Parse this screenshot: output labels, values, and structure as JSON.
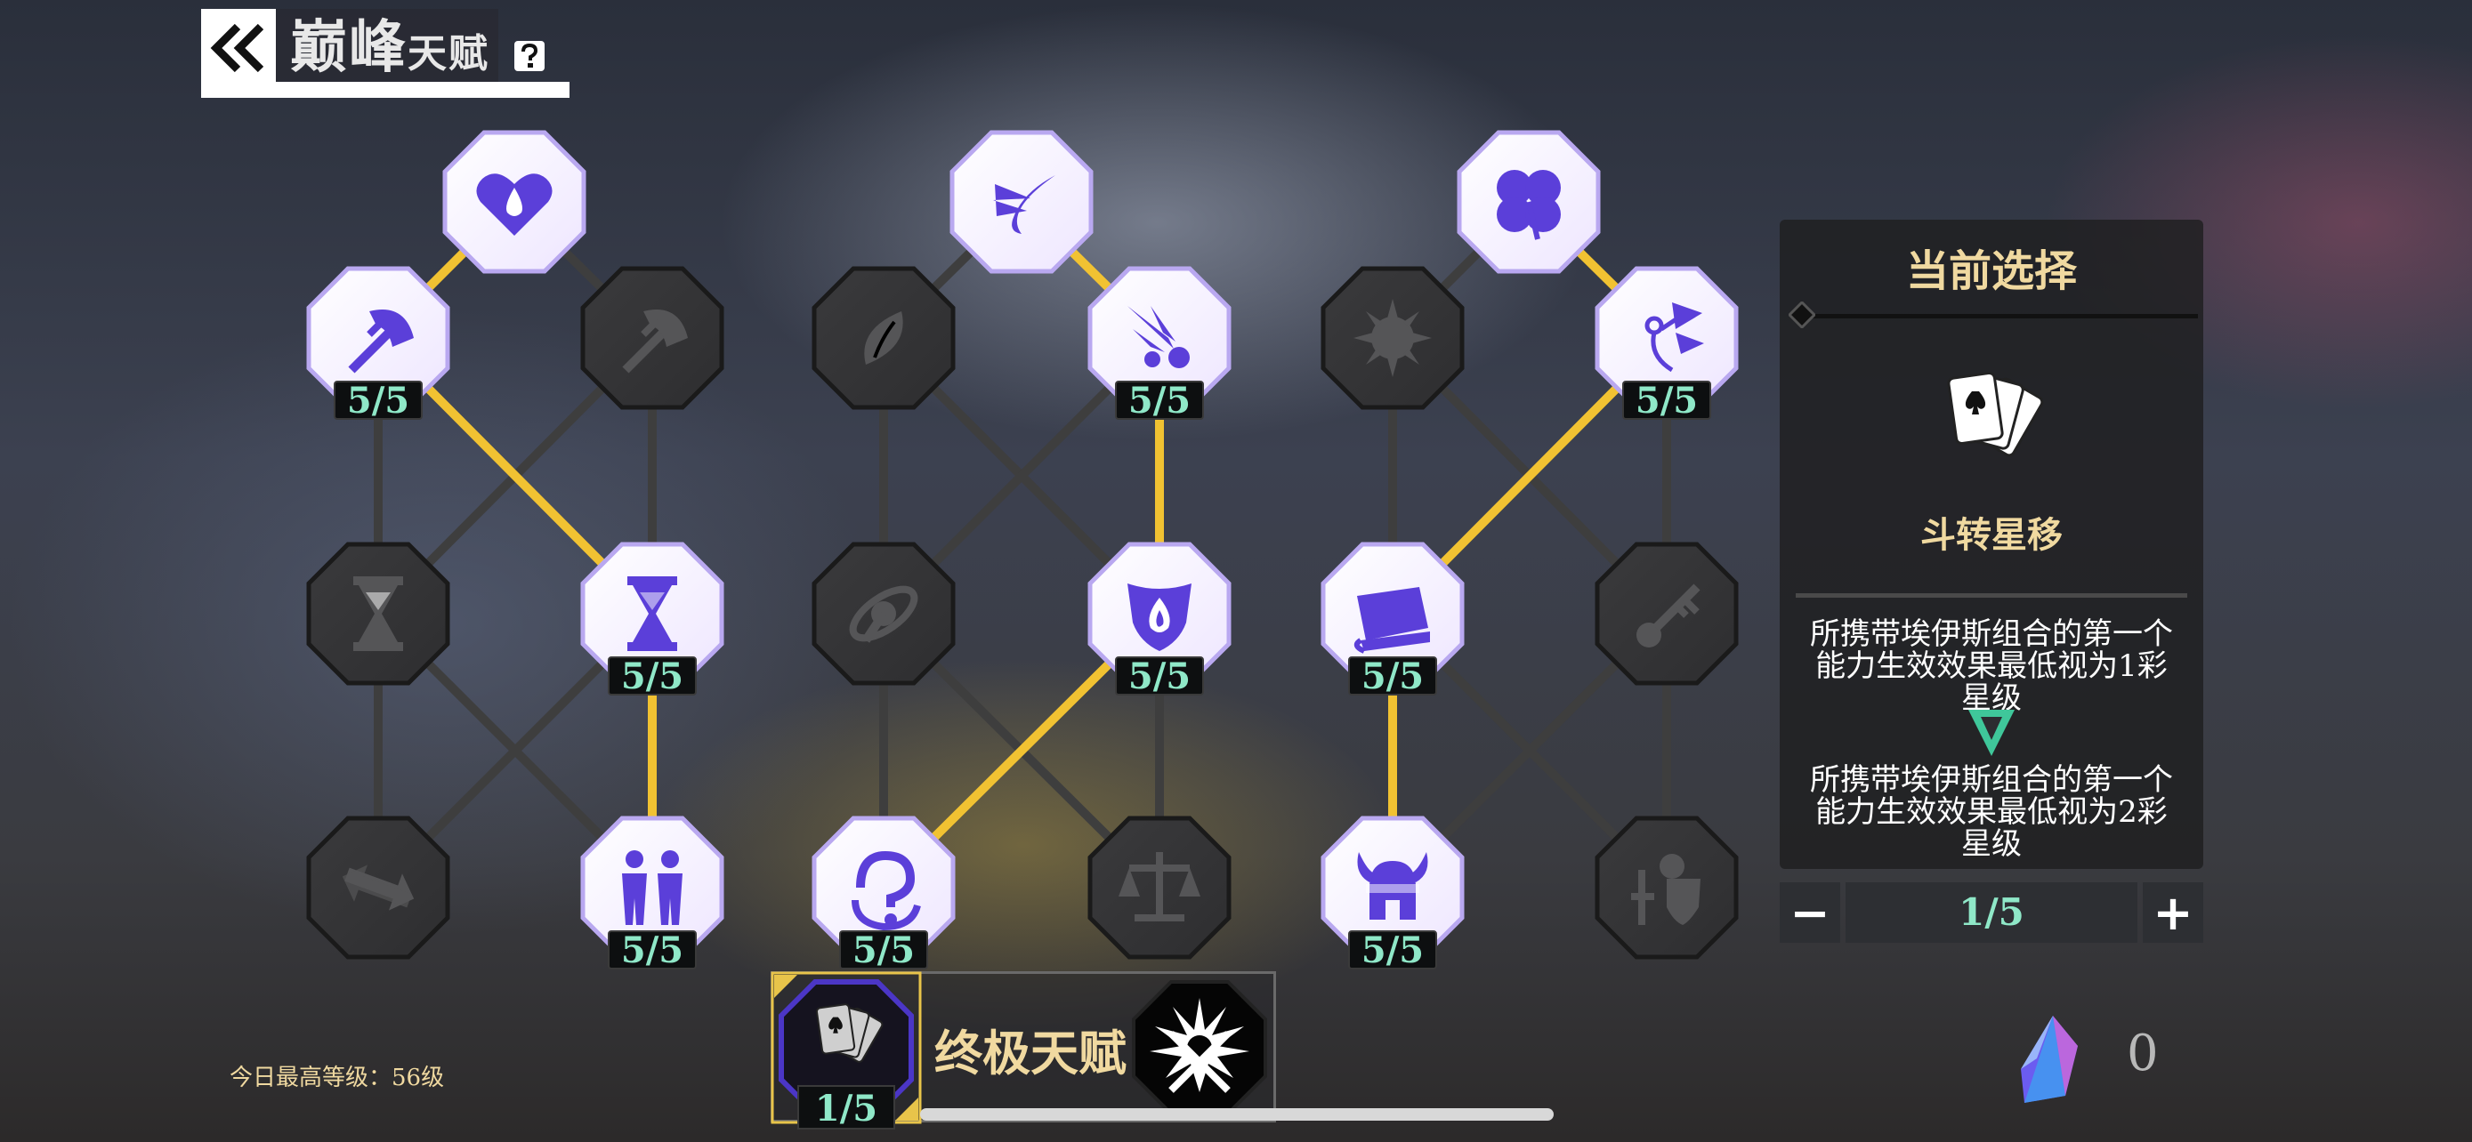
{
  "header": {
    "title": "巅峰",
    "subtitle": "天赋",
    "back_icon": "double-chevron-left-icon",
    "help_icon": "question-icon"
  },
  "tree": {
    "line_active_color": "#f1c232",
    "line_inactive_color": "#3e3e3e",
    "unlocked_color": "#5b3fd9",
    "nodes": [
      {
        "id": "heart-drop",
        "icon": "heart-drop-icon",
        "unlocked": true,
        "level": ""
      },
      {
        "id": "wing",
        "icon": "wing-icon",
        "unlocked": true,
        "level": ""
      },
      {
        "id": "clover",
        "icon": "clover-icon",
        "unlocked": true,
        "level": ""
      },
      {
        "id": "axe-lit",
        "icon": "axe-icon",
        "unlocked": true,
        "level": "5/5"
      },
      {
        "id": "axe-locked",
        "icon": "axe-icon",
        "unlocked": false,
        "level": ""
      },
      {
        "id": "leaf-locked",
        "icon": "leaf-icon",
        "unlocked": false,
        "level": ""
      },
      {
        "id": "comet",
        "icon": "comet-icon",
        "unlocked": true,
        "level": "5/5"
      },
      {
        "id": "spike-ball",
        "icon": "spike-ball-icon",
        "unlocked": false,
        "level": ""
      },
      {
        "id": "shuriken",
        "icon": "shuriken-icon",
        "unlocked": true,
        "level": "5/5"
      },
      {
        "id": "hourglass-locked",
        "icon": "hourglass-icon",
        "unlocked": false,
        "level": ""
      },
      {
        "id": "hourglass",
        "icon": "hourglass-icon",
        "unlocked": true,
        "level": "5/5"
      },
      {
        "id": "orbit",
        "icon": "orbit-icon",
        "unlocked": false,
        "level": ""
      },
      {
        "id": "fire-shield",
        "icon": "fire-shield-icon",
        "unlocked": true,
        "level": "5/5"
      },
      {
        "id": "book",
        "icon": "book-icon",
        "unlocked": true,
        "level": "5/5"
      },
      {
        "id": "key",
        "icon": "key-icon",
        "unlocked": false,
        "level": ""
      },
      {
        "id": "swap",
        "icon": "swap-arrows-icon",
        "unlocked": false,
        "level": ""
      },
      {
        "id": "duo",
        "icon": "two-people-icon",
        "unlocked": true,
        "level": "5/5"
      },
      {
        "id": "question-loop",
        "icon": "question-loop-icon",
        "unlocked": true,
        "level": "5/5"
      },
      {
        "id": "scale",
        "icon": "scale-icon",
        "unlocked": false,
        "level": ""
      },
      {
        "id": "helmet",
        "icon": "viking-helmet-icon",
        "unlocked": true,
        "level": "5/5"
      },
      {
        "id": "knight",
        "icon": "knight-shield-icon",
        "unlocked": false,
        "level": ""
      }
    ]
  },
  "panel": {
    "title": "当前选择",
    "skill_icon": "playing-cards-icon",
    "skill_name": "斗转星移",
    "desc_current": "所携带埃伊斯组合的第一个能力生效效果最低视为1彩星级",
    "arrow_icon": "down-arrow-icon",
    "desc_next": "所携带埃伊斯组合的第一个能力生效效果最低视为2彩星级"
  },
  "stepper": {
    "minus_label": "−",
    "value": "1/5",
    "plus_label": "+"
  },
  "ultimate": {
    "label": "终极天赋",
    "selected_icon": "playing-cards-icon",
    "selected_level": "1/5",
    "other_icon": "starburst-swords-icon"
  },
  "footer": {
    "best_level": "今日最高等级：56级",
    "currency_icon": "crystal-icon",
    "currency_value": "0"
  }
}
